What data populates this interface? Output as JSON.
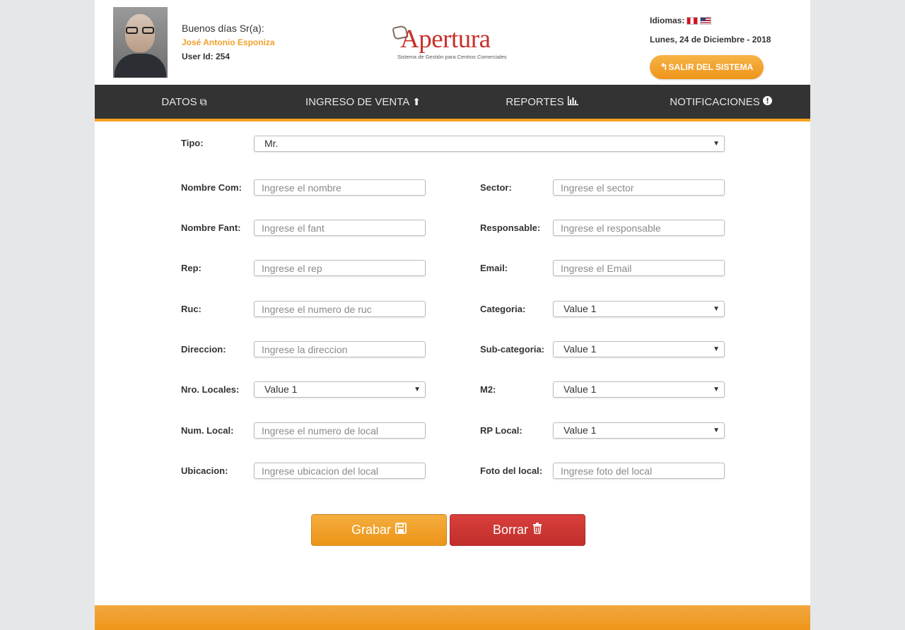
{
  "header": {
    "greeting": "Buenos días Sr(a):",
    "user_name": "José Antonio Esponiza",
    "user_id": "User Id: 254",
    "logo_word": "Apertura",
    "logo_tagline": "Sistema de Gestión para Centros Comerciales",
    "languages_label": "Idiomas:",
    "date": "Lunes, 24 de Diciembre - 2018",
    "logout_label": "SALIR DEL SISTEMA"
  },
  "nav": {
    "items": [
      {
        "label": "DATOS",
        "icon": "copy-icon"
      },
      {
        "label": "INGRESO DE VENTA",
        "icon": "arrow-up-circle-icon"
      },
      {
        "label": "REPORTES",
        "icon": "bar-chart-icon"
      },
      {
        "label": "NOTIFICACIONES",
        "icon": "exclamation-circle-icon"
      }
    ]
  },
  "form": {
    "tipo": {
      "label": "Tipo:",
      "value": "Mr."
    },
    "nombre_com": {
      "label": "Nombre Com:",
      "placeholder": "Ingrese el nombre"
    },
    "sector": {
      "label": "Sector:",
      "placeholder": "Ingrese el sector"
    },
    "nombre_fant": {
      "label": "Nombre Fant:",
      "placeholder": "Ingrese el fant"
    },
    "responsable": {
      "label": "Responsable:",
      "placeholder": "Ingrese el responsable"
    },
    "rep": {
      "label": "Rep:",
      "placeholder": "Ingrese el rep"
    },
    "email": {
      "label": "Email:",
      "placeholder": "Ingrese el Email"
    },
    "ruc": {
      "label": "Ruc:",
      "placeholder": "Ingrese el numero de ruc"
    },
    "categoria": {
      "label": "Categoria:",
      "value": "Value 1"
    },
    "direccion": {
      "label": "Direccion:",
      "placeholder": "Ingrese la direccion"
    },
    "subcategoria": {
      "label": "Sub-categoria:",
      "value": "Value 1"
    },
    "nro_locales": {
      "label": "Nro. Locales:",
      "value": "Value 1"
    },
    "m2": {
      "label": "M2:",
      "value": "Value 1"
    },
    "num_local": {
      "label": "Num. Local:",
      "placeholder": "Ingrese el numero de local"
    },
    "rp_local": {
      "label": "RP Local:",
      "value": "Value 1"
    },
    "ubicacion": {
      "label": "Ubicacion:",
      "placeholder": "Ingrese ubicacion del local"
    },
    "foto_local": {
      "label": "Foto del local:",
      "placeholder": "Ingrese foto del local"
    }
  },
  "actions": {
    "save_label": "Grabar",
    "delete_label": "Borrar"
  },
  "colors": {
    "accent": "#f5a21f",
    "nav_bg": "#333333",
    "user_name": "#f0a12b",
    "delete": "#c8312b",
    "logo": "#c8312b"
  }
}
